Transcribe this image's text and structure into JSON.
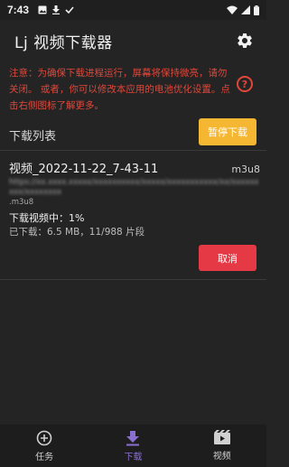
{
  "status_bar": {
    "time": "7:43",
    "icons": [
      "image-icon",
      "download-icon",
      "check-icon",
      "wifi-icon",
      "signal-icon",
      "battery-icon"
    ]
  },
  "app_bar": {
    "title": "Lj 视频下载器",
    "settings_icon": "gear-icon"
  },
  "notice": {
    "text": "注意：为确保下载进程运行，屏幕将保持微亮，请勿关闭。 或者，你可以修改本应用的电池优化设置。点击右侧图标了解更多。",
    "help_icon": "help-circle-icon",
    "color": "#e0473a"
  },
  "download_list": {
    "title": "下载列表",
    "pause_label": "暂停下载",
    "tasks": [
      {
        "name": "视频_2022-11-22_7-43-11",
        "type": "m3u8",
        "url_visible_end": ".m3u8",
        "status": "下载视频中：1%",
        "progress": "已下载：6.5 MB，11/988 片段",
        "percent": 1,
        "cancel_label": "取消"
      }
    ]
  },
  "bottom_nav": {
    "items": [
      {
        "label": "任务",
        "icon": "plus-circle-icon",
        "active": false
      },
      {
        "label": "下载",
        "icon": "download-icon",
        "active": true
      },
      {
        "label": "视频",
        "icon": "video-icon",
        "active": false
      }
    ],
    "accent": "#8a6fd1"
  },
  "colors": {
    "background": "#242424",
    "pause_button": "#f5b731",
    "cancel_button": "#e53945"
  }
}
